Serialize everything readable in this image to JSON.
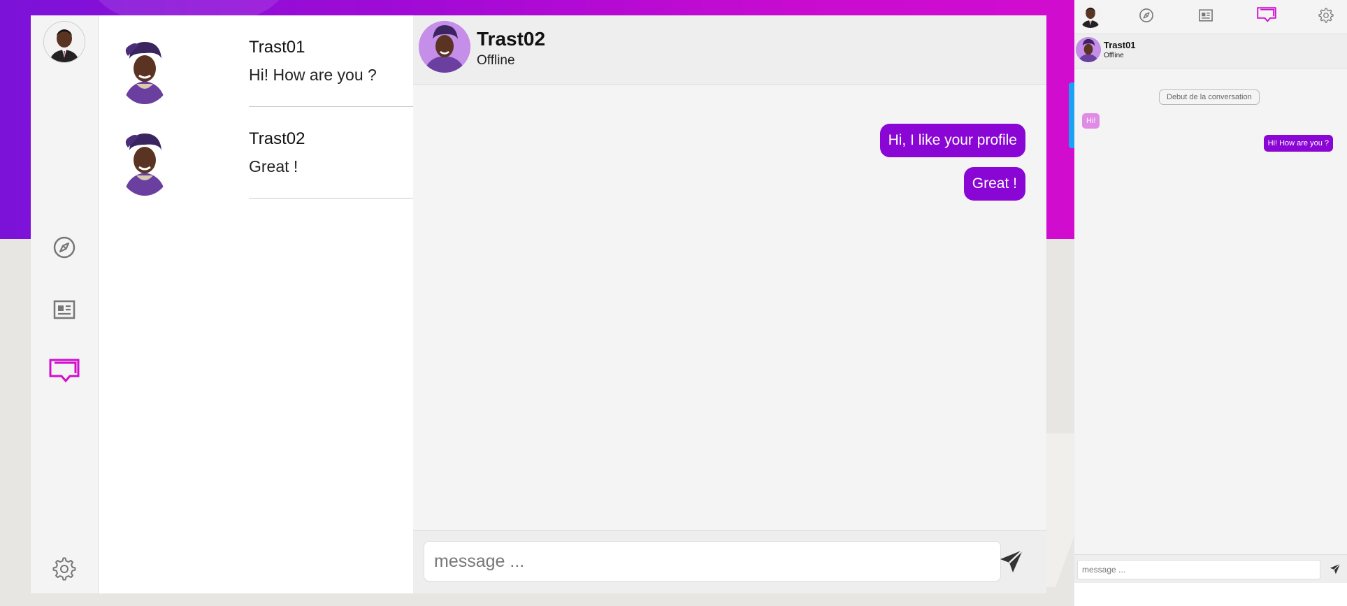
{
  "colors": {
    "accent": "#8a06d4",
    "accent_light": "#e08be6",
    "nav_active": "#d00fcf",
    "background_gradient_start": "#7b12d8",
    "background_gradient_end": "#d10ccf"
  },
  "rail": {
    "items": [
      {
        "icon": "compass-icon"
      },
      {
        "icon": "newspaper-icon"
      },
      {
        "icon": "chat-icon",
        "active": true
      }
    ],
    "settings_icon": "gear-icon"
  },
  "conversations": [
    {
      "name": "Trast01",
      "preview": "Hi! How are you ?"
    },
    {
      "name": "Trast02",
      "preview": "Great !"
    }
  ],
  "chat": {
    "contact_name": "Trast02",
    "contact_status": "Offline",
    "messages": [
      {
        "text": "Hi, I like your profile",
        "direction": "out"
      },
      {
        "text": "Great !",
        "direction": "out"
      }
    ],
    "composer_placeholder": "message ..."
  },
  "mini_panel": {
    "contact_name": "Trast01",
    "contact_status": "Offline",
    "conversation_start_label": "Debut de la conversation",
    "messages": [
      {
        "text": "Hi!",
        "direction": "in"
      },
      {
        "text": "Hi! How are you ?",
        "direction": "out"
      }
    ],
    "composer_placeholder": "message ..."
  }
}
